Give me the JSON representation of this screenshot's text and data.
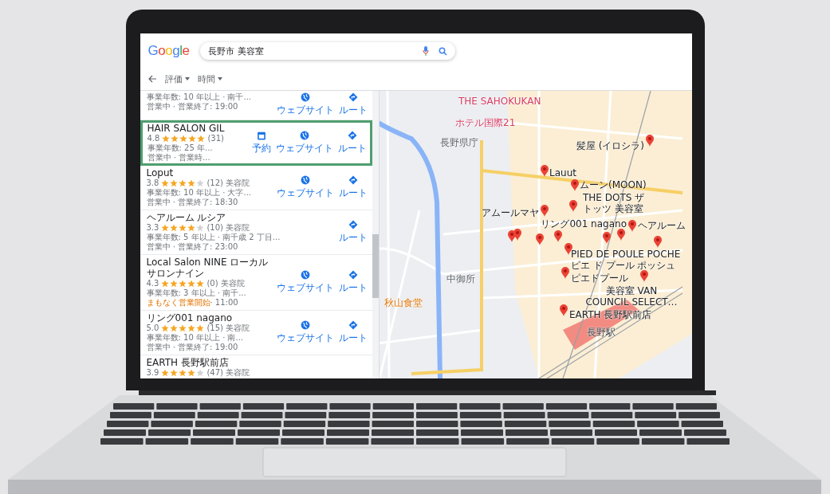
{
  "search": {
    "logo": "Google",
    "query": "長野市 美容室"
  },
  "filters": [
    {
      "label": "評価"
    },
    {
      "label": "時間"
    }
  ],
  "results": [
    {
      "highlighted": false,
      "details": [
        "事業年数: 10 年以上 · 南千...",
        "営業中 · 営業終了: 19:00"
      ],
      "actions": [
        {
          "kind": "website",
          "label": "ウェブサイト"
        },
        {
          "kind": "route",
          "label": "ルート"
        }
      ]
    },
    {
      "name": "HAIR SALON GIL",
      "rating": "4.8",
      "stars": 5,
      "review_count": "(31)",
      "highlighted": true,
      "details": [
        "事業年数: 25 年...",
        "営業中 · 営業時..."
      ],
      "actions": [
        {
          "kind": "reserve",
          "label": "予約"
        },
        {
          "kind": "website",
          "label": "ウェブサイト"
        },
        {
          "kind": "route",
          "label": "ルート"
        }
      ]
    },
    {
      "name": "Loput",
      "rating": "3.8",
      "stars": 4,
      "review_count": "(12)",
      "category": "美容院",
      "highlighted": false,
      "details": [
        "事業年数: 10 年以上 · 大字...",
        "営業中 · 営業終了: 18:30"
      ],
      "actions": [
        {
          "kind": "website",
          "label": "ウェブサイト"
        },
        {
          "kind": "route",
          "label": "ルート"
        }
      ]
    },
    {
      "name": "ヘアルーム ルシア",
      "rating": "3.3",
      "stars": 4,
      "review_count": "(10)",
      "category": "美容院",
      "highlighted": false,
      "details": [
        "事業年数: 5 年以上 · 南千歳 2 丁目...",
        "営業中 · 営業終了: 23:00"
      ],
      "actions": [
        {
          "kind": "route",
          "label": "ルート"
        }
      ]
    },
    {
      "name": "Local Salon NINE ローカルサロンナイン",
      "rating": "4.3",
      "stars": 5,
      "review_count": "(0)",
      "category": "美容院",
      "highlighted": false,
      "details": [
        "事業年数: 3 年以上 · 南千..."
      ],
      "opening": {
        "status": "まもなく営業開始",
        "time": "· 11:00"
      },
      "actions": [
        {
          "kind": "website",
          "label": "ウェブサイト"
        },
        {
          "kind": "route",
          "label": "ルート"
        }
      ]
    },
    {
      "name": "リング001 nagano",
      "rating": "5.0",
      "stars": 5,
      "review_count": "(15)",
      "category": "美容院",
      "highlighted": false,
      "details": [
        "事業年数: 10 年以上 · 南...",
        "営業中 · 営業終了: 19:00"
      ],
      "actions": [
        {
          "kind": "website",
          "label": "ウェブサイト"
        },
        {
          "kind": "route",
          "label": "ルート"
        }
      ]
    },
    {
      "name": "EARTH 長野駅前店",
      "rating": "3.9",
      "stars": 4,
      "review_count": "(47)",
      "category": "美容院",
      "highlighted": false
    }
  ],
  "map": {
    "places": [
      {
        "label": "THE SAHOKUKAN",
        "kind": "hotel"
      },
      {
        "label": "ホテル国際21",
        "kind": "hotel"
      },
      {
        "label": "長野県庁",
        "kind": "landmark"
      },
      {
        "label": "髪屋 (イロシラ)",
        "kind": "salon"
      },
      {
        "label": "Lauut",
        "kind": "salon"
      },
      {
        "label": "ムーン(MOON)",
        "kind": "salon"
      },
      {
        "label": "アムールマヤ",
        "kind": "salon"
      },
      {
        "label": "THE DOTS ザトッツ 美容室",
        "kind": "salon"
      },
      {
        "label": "リング001 nagano",
        "kind": "salon"
      },
      {
        "label": "ヘアルーム",
        "kind": "salon"
      },
      {
        "label": "PIED DE POULE POCHE ピエ ド プール ポッシュ",
        "kind": "salon"
      },
      {
        "label": "中御所",
        "kind": "area"
      },
      {
        "label": "ピエドプール",
        "kind": "salon"
      },
      {
        "label": "秋山食堂",
        "kind": "restaurant"
      },
      {
        "label": "美容室 VAN COUNCIL SELECT…",
        "kind": "salon"
      },
      {
        "label": "EARTH 長野駅前店",
        "kind": "salon"
      },
      {
        "label": "長野駅",
        "kind": "station"
      }
    ]
  }
}
